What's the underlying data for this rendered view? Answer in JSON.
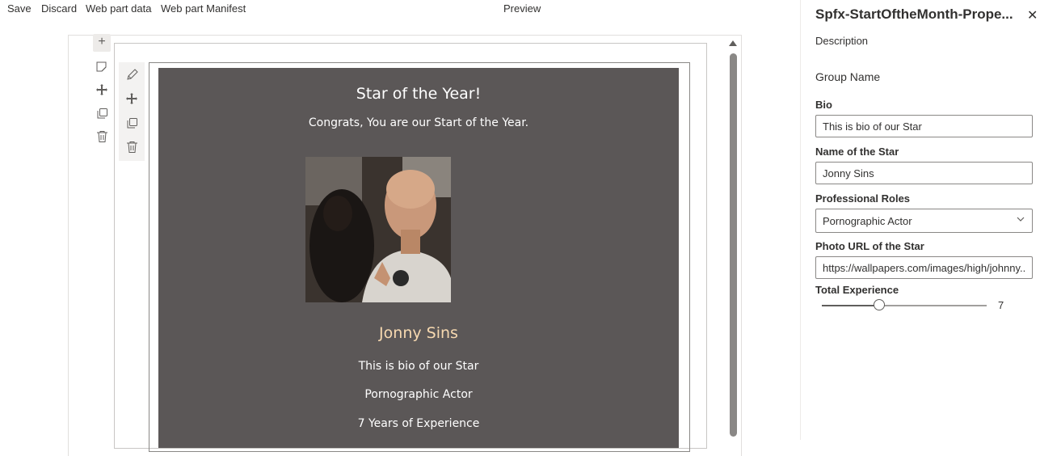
{
  "toolbar": {
    "save": "Save",
    "discard": "Discard",
    "web_part_data": "Web part data",
    "web_part_manifest": "Web part Manifest",
    "preview": "Preview"
  },
  "canvas": {
    "add_section": "+"
  },
  "card": {
    "title": "Star of the Year!",
    "subtitle": "Congrats, You are our Start of the Year.",
    "name": "Jonny Sins",
    "bio": "This is bio of our Star",
    "role": "Pornographic Actor",
    "experience": "7 Years of Experience",
    "background_color": "#5b5757",
    "name_color": "#f7d9b0"
  },
  "property_pane": {
    "title": "Spfx-StartOftheMonth-Prope...",
    "close_icon": "close-icon",
    "description_label": "Description",
    "group_name": "Group Name",
    "fields": {
      "bio": {
        "label": "Bio",
        "value": "This is bio of our Star"
      },
      "name": {
        "label": "Name of the Star",
        "value": "Jonny Sins"
      },
      "roles": {
        "label": "Professional Roles",
        "value": "Pornographic Actor"
      },
      "photo": {
        "label": "Photo URL of the Star",
        "value": "https://wallpapers.com/images/high/johnny..."
      },
      "experience": {
        "label": "Total Experience",
        "value": "7",
        "fraction": 0.35
      }
    }
  }
}
